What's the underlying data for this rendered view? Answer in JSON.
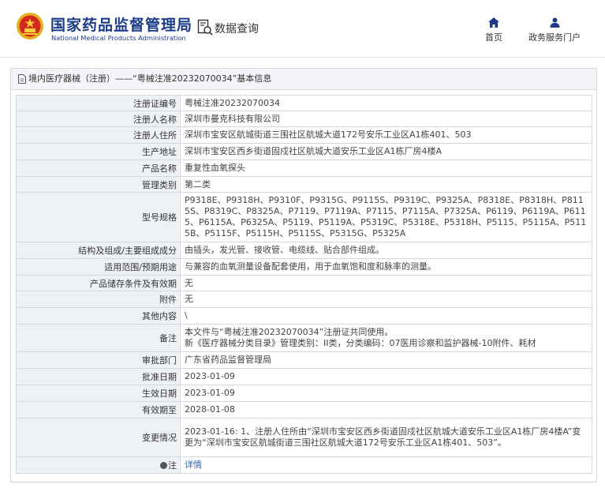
{
  "header": {
    "site_title": "国家药品监督管理局",
    "site_subtitle": "National Medical Products Administration",
    "query_label": "数据查询",
    "nav": {
      "home": "首页",
      "portal": "政务服务门户"
    }
  },
  "panel": {
    "breadcrumb": "境内医疗器械（注册）——“粤械注准20232070034”基本信息"
  },
  "record": [
    {
      "label": "注册证编号",
      "value": "粤械注准20232070034"
    },
    {
      "label": "注册人名称",
      "value": "深圳市曼克科技有限公司"
    },
    {
      "label": "注册人住所",
      "value": "深圳市宝安区航城街道三围社区航城大道172号安乐工业区A1栋401、503"
    },
    {
      "label": "生产地址",
      "value": "深圳市宝安区西乡街道固戍社区航城大道安乐工业区A1栋厂房4楼A"
    },
    {
      "label": "产品名称",
      "value": "重复性血氧探头"
    },
    {
      "label": "管理类别",
      "value": "第二类"
    },
    {
      "label": "型号规格",
      "value": "P9318E、P9318H、P9310F、P9315G、P9115S、P9319C、P9325A、P8318E、P8318H、P8115S、P8319C、P8325A、P7119、P7119A、P7115、P7115A、P7325A、P6119、P6119A、P6115、P6115A、P6325A、P5119、P5119A、P5319C、P5318E、P5318H、P5115、P5115A、P5115B、P5115F、P5115H、P5115S、P5315G、P5325A"
    },
    {
      "label": "结构及组成/主要组成成分",
      "value": "由插头，发光管、接收管、电缆线、贴合部件组成。"
    },
    {
      "label": "适用范围/预期用途",
      "value": "与兼容的血氧测量设备配套使用，用于血氧饱和度和脉率的测量。"
    },
    {
      "label": "产品储存条件及有效期",
      "value": "无"
    },
    {
      "label": "附件",
      "value": "无"
    },
    {
      "label": "其他内容",
      "value": "\\"
    },
    {
      "label": "备注",
      "value": "本文件与“粤械注准20232070034”注册证共同使用。",
      "value2": "新《医疗器械分类目录》管理类别：II类，分类编码：07医用诊察和监护器械-10附件、耗材"
    },
    {
      "label": "审批部门",
      "value": "广东省药品监督管理局"
    },
    {
      "label": "批准日期",
      "value": "2023-01-09"
    },
    {
      "label": "生效日期",
      "value": "2023-01-09"
    },
    {
      "label": "有效期至",
      "value": "2028-01-08"
    },
    {
      "label": "变更情况",
      "value": "2023-01-16: 1、注册人住所由“深圳市宝安区西乡街道固戍社区航城大道安乐工业区A1栋厂房4楼A”变更为“深圳市宝安区航城街道三围社区航城大道172号安乐工业区A1栋401、503”。"
    },
    {
      "label": "注",
      "value": "详情"
    }
  ],
  "colors": {
    "brand": "#1d3c87",
    "link": "#2a63b8",
    "label_bg": "#eef1f6",
    "border": "#d4d9e0"
  }
}
